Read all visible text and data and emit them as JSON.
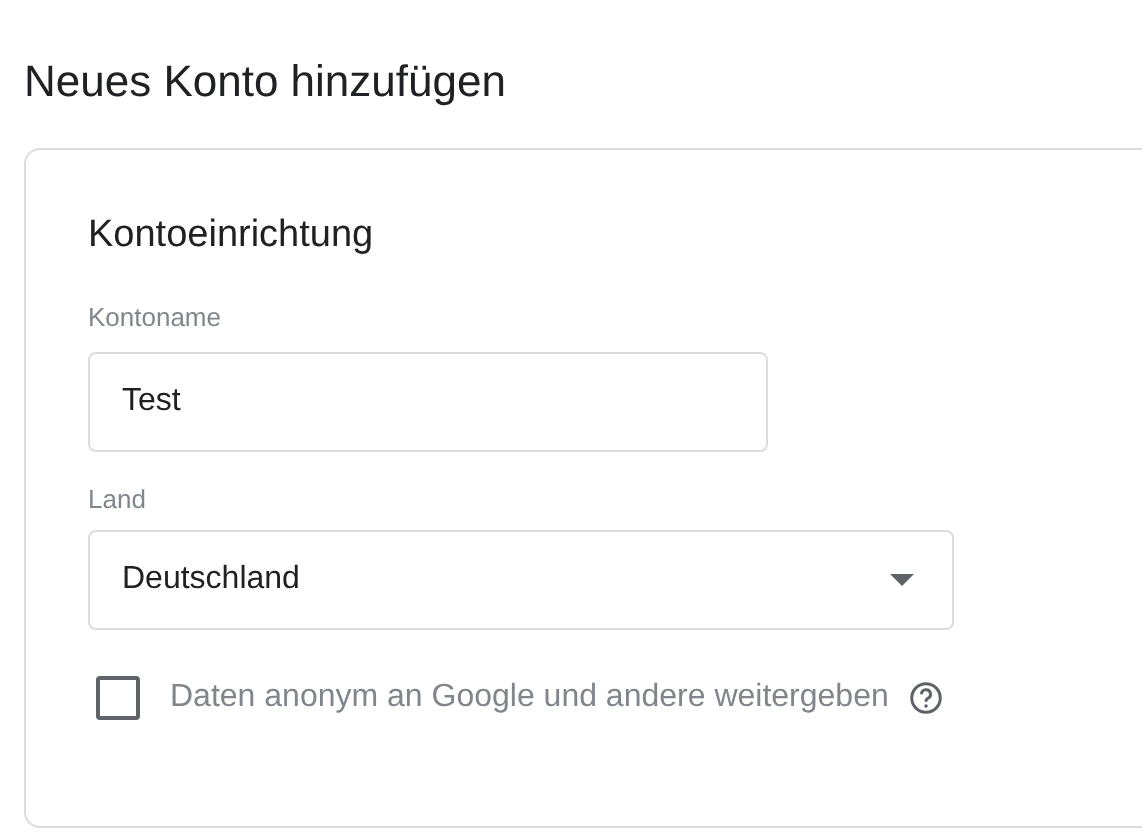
{
  "page_title": "Neues Konto hinzufügen",
  "card": {
    "heading": "Kontoeinrichtung",
    "account_name": {
      "label": "Kontoname",
      "value": "Test"
    },
    "country": {
      "label": "Land",
      "value": "Deutschland"
    },
    "share_data": {
      "label": "Daten anonym an Google und andere weitergeben",
      "checked": false
    }
  }
}
